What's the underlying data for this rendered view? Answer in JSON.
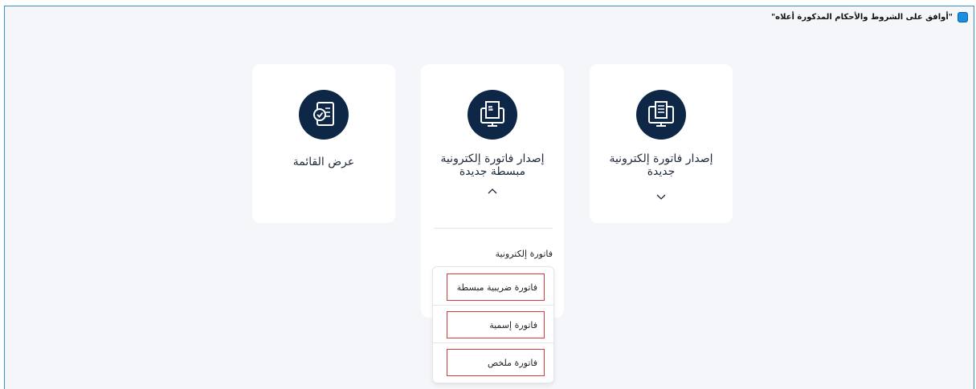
{
  "terms": {
    "label": "\"أوافق على الشروط والأحكام المذكورة أعلاه\""
  },
  "cards": {
    "new_invoice": {
      "title_line1": "إصدار فاتورة إلكترونية",
      "title_line2": "جديدة"
    },
    "simplified_invoice": {
      "title_line1": "إصدار فاتورة إلكترونية",
      "title_line2": "مبسطة جديدة"
    },
    "list": {
      "title": "عرض القائمة"
    }
  },
  "submenu": {
    "label": "فاتورة إلكترونية",
    "items": [
      "فاتورة ضريبية مبسطة",
      "فاتورة إسمية",
      "فاتورة ملخص"
    ]
  },
  "colors": {
    "accent": "#0e2746",
    "highlight": "#d33a3a",
    "checkbox": "#1a8fe0"
  }
}
